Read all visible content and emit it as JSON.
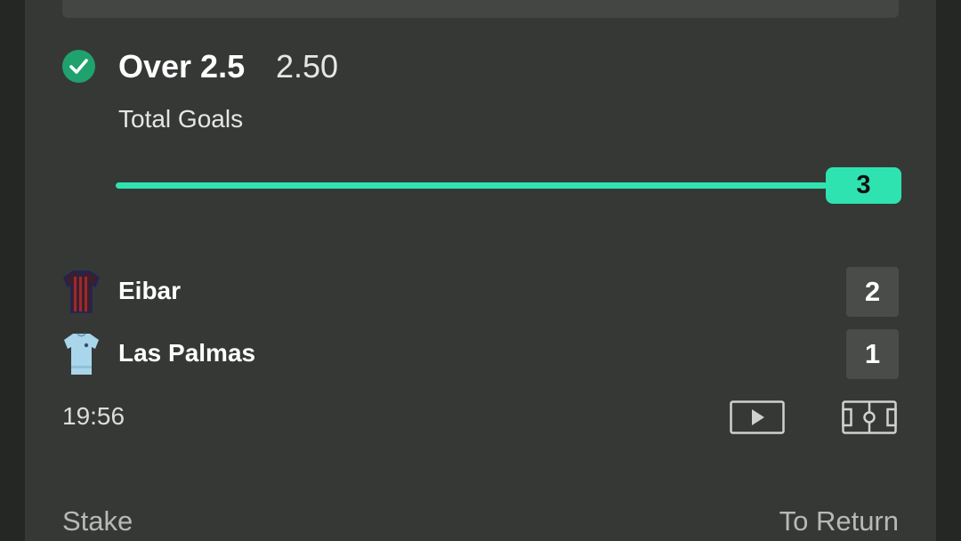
{
  "bet": {
    "selection": "Over 2.5",
    "odds": "2.50",
    "market": "Total Goals",
    "progress_value": "3",
    "progress_fraction": 1.0,
    "status_icon": "check-icon"
  },
  "match": {
    "home": {
      "name": "Eibar",
      "score": "2",
      "kit_icon": "eibar-kit-icon"
    },
    "away": {
      "name": "Las Palmas",
      "score": "1",
      "kit_icon": "las-palmas-kit-icon"
    },
    "time": "19:56"
  },
  "actions": {
    "video_icon": "video-play-icon",
    "pitch_icon": "pitch-icon"
  },
  "footer": {
    "stake_label": "Stake",
    "return_label": "To Return"
  },
  "colors": {
    "accent": "#2fe3b0",
    "check_green": "#1fa26d",
    "card_bg": "#363836"
  }
}
